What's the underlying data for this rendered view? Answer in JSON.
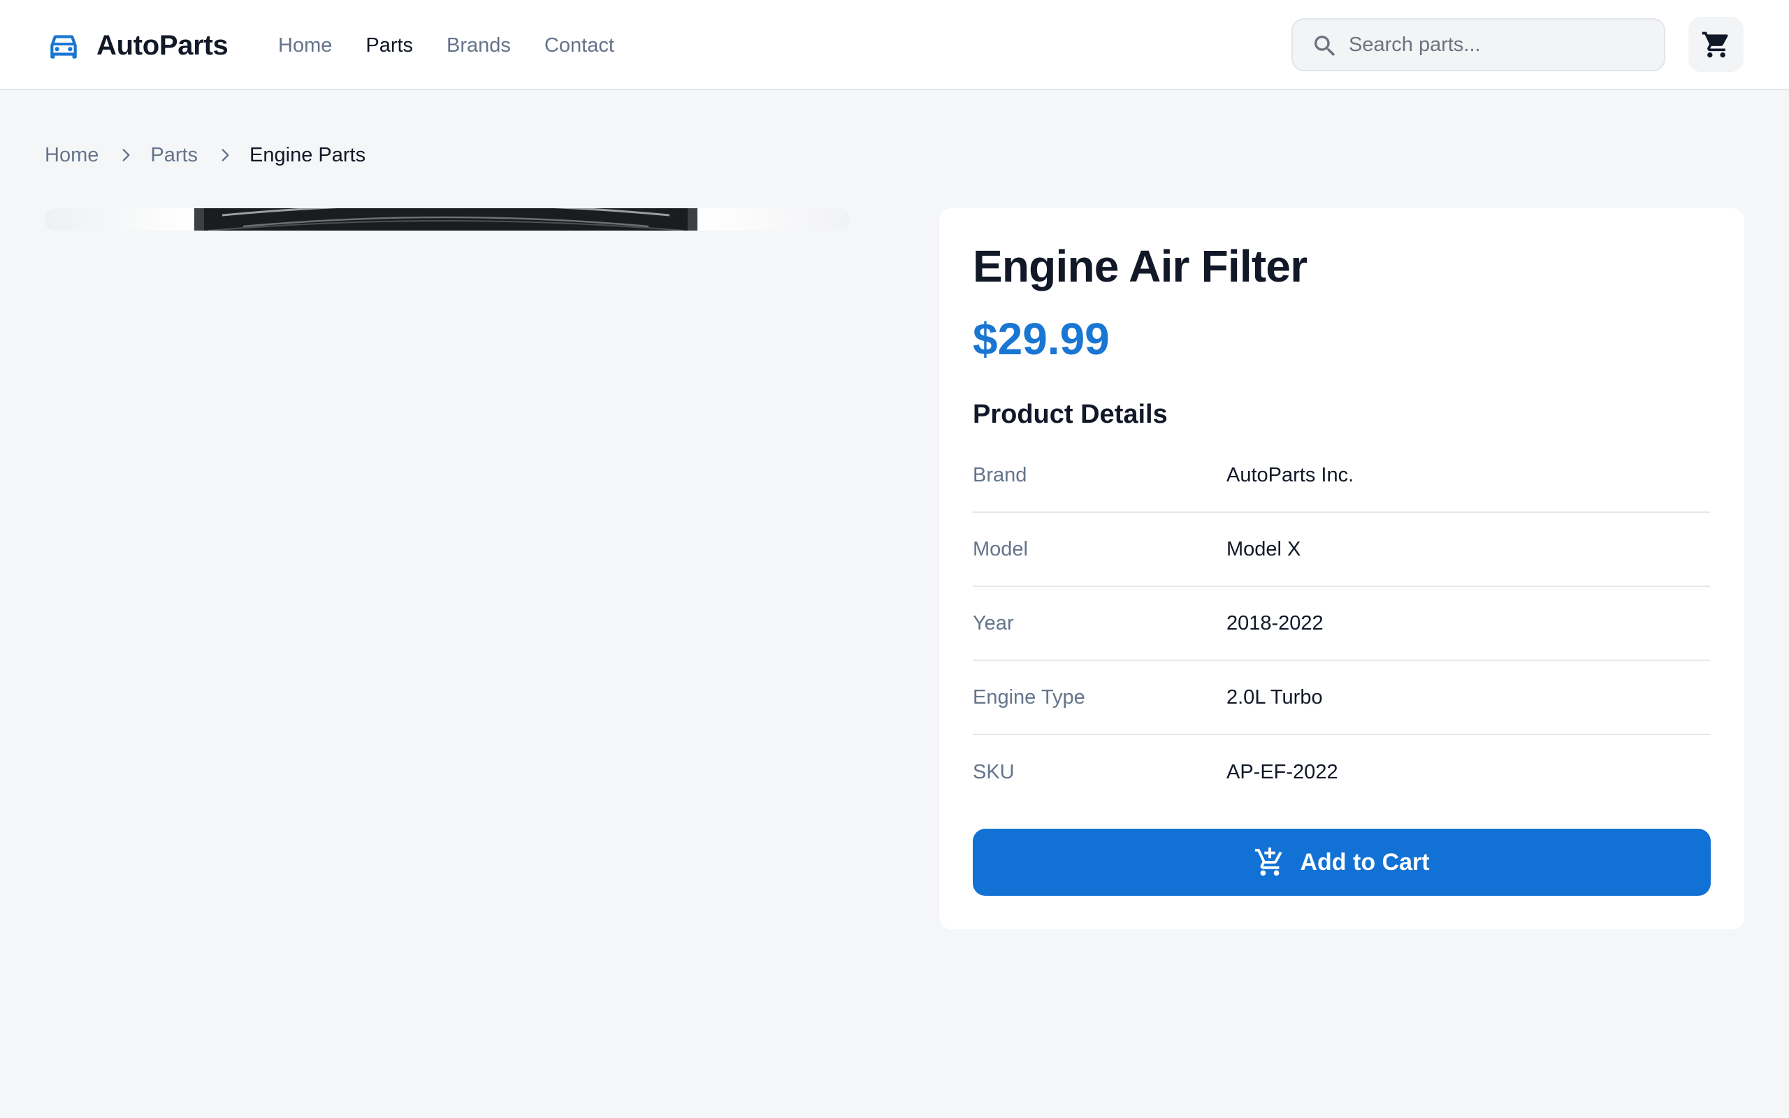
{
  "brand": {
    "name": "AutoParts",
    "icon": "car-icon",
    "accent": "#1976d2"
  },
  "nav": {
    "items": [
      {
        "label": "Home",
        "active": false
      },
      {
        "label": "Parts",
        "active": true
      },
      {
        "label": "Brands",
        "active": false
      },
      {
        "label": "Contact",
        "active": false
      }
    ]
  },
  "search": {
    "placeholder": "Search parts...",
    "value": "",
    "icon": "search-icon"
  },
  "cart": {
    "icon": "cart-icon"
  },
  "breadcrumb": {
    "items": [
      "Home",
      "Parts",
      "Engine Parts"
    ],
    "separator_icon": "chevron-right-icon"
  },
  "product": {
    "title": "Engine Air Filter",
    "price": "$29.99",
    "details_heading": "Product Details",
    "specs": [
      {
        "label": "Brand",
        "value": "AutoParts Inc."
      },
      {
        "label": "Model",
        "value": "Model X"
      },
      {
        "label": "Year",
        "value": "2018-2022"
      },
      {
        "label": "Engine Type",
        "value": "2.0L Turbo"
      },
      {
        "label": "SKU",
        "value": "AP-EF-2022"
      }
    ],
    "add_to_cart_label": "Add to Cart",
    "add_to_cart_icon": "add-shopping-cart-icon",
    "button_color": "#1271d4"
  }
}
